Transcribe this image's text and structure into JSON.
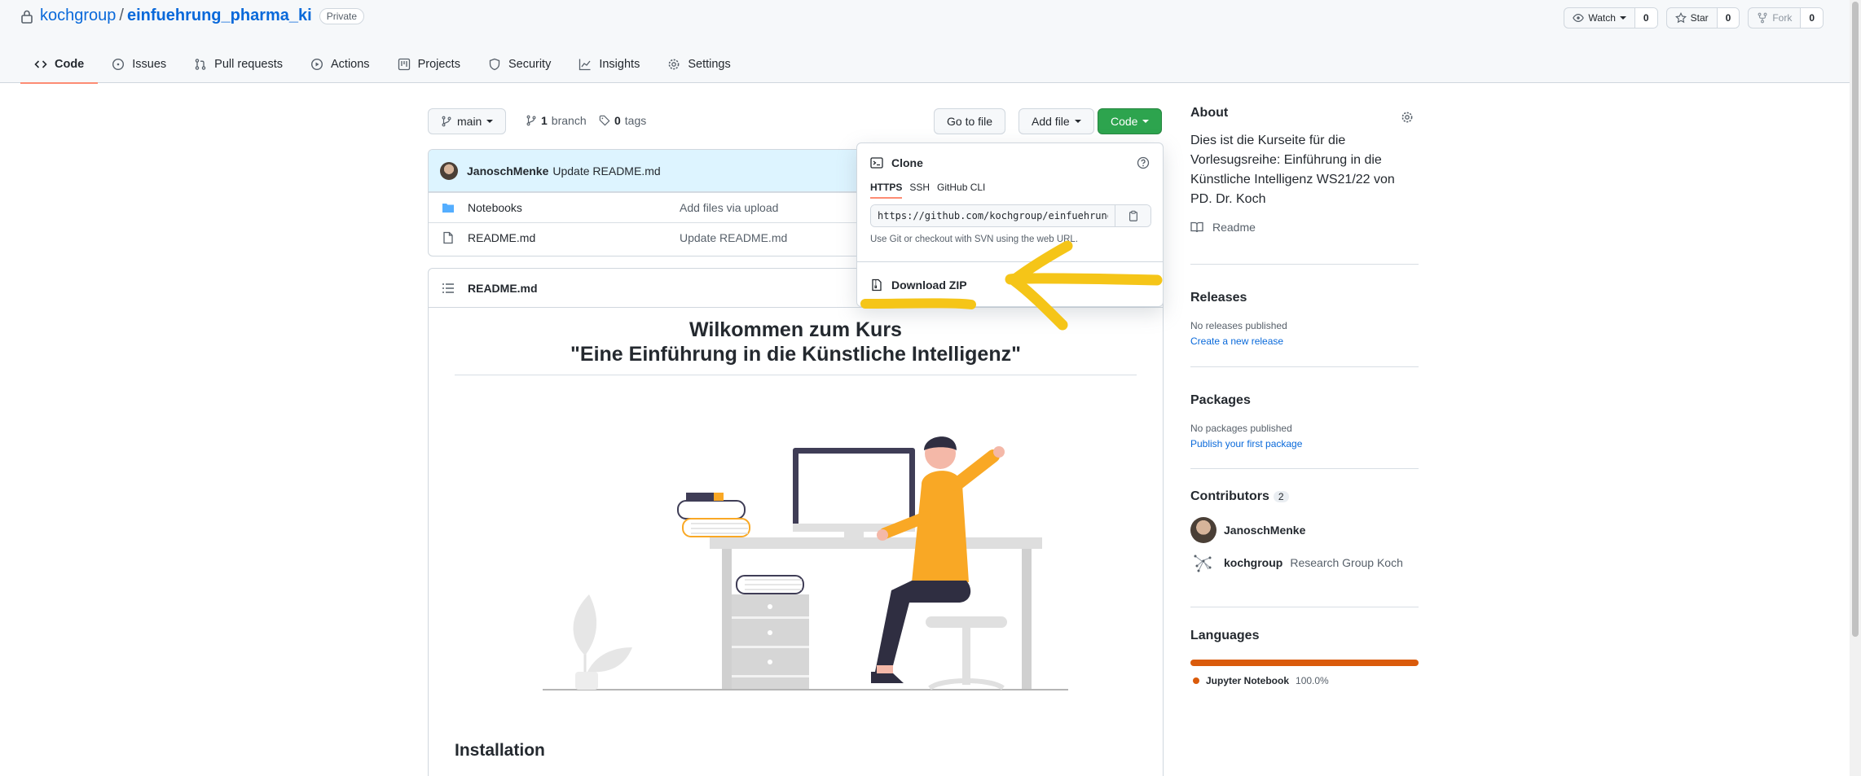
{
  "repo": {
    "owner": "kochgroup",
    "separator": "/",
    "name": "einfuehrung_pharma_ki",
    "visibility": "Private"
  },
  "header_actions": {
    "watch": {
      "label": "Watch",
      "count": "0"
    },
    "star": {
      "label": "Star",
      "count": "0"
    },
    "fork": {
      "label": "Fork",
      "count": "0"
    }
  },
  "tabs": [
    {
      "label": "Code",
      "icon": "code-icon",
      "active": true
    },
    {
      "label": "Issues",
      "icon": "issue-icon"
    },
    {
      "label": "Pull requests",
      "icon": "pull-request-icon"
    },
    {
      "label": "Actions",
      "icon": "play-icon"
    },
    {
      "label": "Projects",
      "icon": "project-icon"
    },
    {
      "label": "Security",
      "icon": "shield-icon"
    },
    {
      "label": "Insights",
      "icon": "graph-icon"
    },
    {
      "label": "Settings",
      "icon": "gear-icon"
    }
  ],
  "toolbar": {
    "branch": "main",
    "branch_count": "1",
    "branch_label": "branch",
    "tag_count": "0",
    "tag_label": "tags",
    "goto_file": "Go to file",
    "add_file": "Add file",
    "code": "Code"
  },
  "commit": {
    "author": "JanoschMenke",
    "message": "Update README.md"
  },
  "files": [
    {
      "name": "Notebooks",
      "message": "Add files via upload",
      "type": "folder"
    },
    {
      "name": "README.md",
      "message": "Update README.md",
      "type": "file"
    }
  ],
  "readme": {
    "filename": "README.md",
    "heading_line1": "Wilkommen zum Kurs",
    "heading_line2": "\"Eine Einführung in die Künstliche Intelligenz\"",
    "section": "Installation"
  },
  "clone": {
    "title": "Clone",
    "tabs": [
      "HTTPS",
      "SSH",
      "GitHub CLI"
    ],
    "url": "https://github.com/kochgroup/einfuehrung_pharma_ki.git",
    "hint": "Use Git or checkout with SVN using the web URL.",
    "download": "Download ZIP"
  },
  "about": {
    "title": "About",
    "description": "Dies ist die Kurseite für die Vorlesugsreihe: Einführung in die Künstliche Intelligenz WS21/22 von PD. Dr. Koch",
    "readme_label": "Readme"
  },
  "releases": {
    "title": "Releases",
    "empty": "No releases published",
    "link": "Create a new release"
  },
  "packages": {
    "title": "Packages",
    "empty": "No packages published",
    "link": "Publish your first package"
  },
  "contributors": {
    "title": "Contributors",
    "count": "2",
    "list": [
      {
        "login": "JanoschMenke",
        "name": ""
      },
      {
        "login": "kochgroup",
        "name": "Research Group Koch"
      }
    ]
  },
  "languages": {
    "title": "Languages",
    "list": [
      {
        "name": "Jupyter Notebook",
        "percent": "100.0%",
        "color": "#da5b0b"
      }
    ]
  },
  "colors": {
    "link": "#0969da",
    "green": "#2da44e",
    "active_tab": "#fd8c73",
    "annotation": "#f5c518"
  }
}
